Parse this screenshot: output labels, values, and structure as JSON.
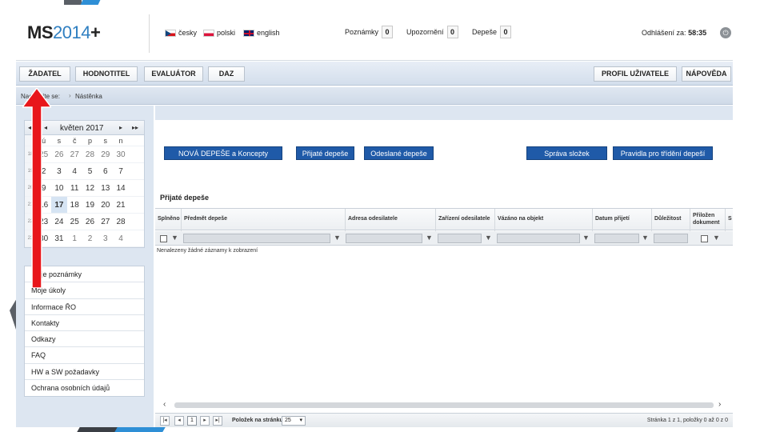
{
  "header": {
    "logo_ms": "MS",
    "logo_year": "2014",
    "logo_plus": "+",
    "languages": [
      {
        "label": "česky",
        "flag": "cz"
      },
      {
        "label": "polski",
        "flag": "pl"
      },
      {
        "label": "english",
        "flag": "gb"
      }
    ],
    "counters": [
      {
        "label": "Poznámky",
        "value": "0"
      },
      {
        "label": "Upozornění",
        "value": "0"
      },
      {
        "label": "Depeše",
        "value": "0"
      }
    ],
    "session_label": "Odhlášení za:",
    "session_time": "58:35",
    "power_icon": "power-icon"
  },
  "nav": {
    "left": [
      "ŽADATEL",
      "HODNOTITEL",
      "EVALUÁTOR",
      "DAZ"
    ],
    "right": [
      "PROFIL UŽIVATELE",
      "NÁPOVĚDA"
    ]
  },
  "breadcrumb": {
    "label": "Nacházíte se:",
    "current": "Nástěnka"
  },
  "calendar": {
    "month": "květen 2017",
    "nav": {
      "prev_year": "◂◂",
      "prev": "◂",
      "next": "▸",
      "next_year": "▸▸"
    },
    "dow": [
      "ú",
      "s",
      "č",
      "p",
      "s",
      "n"
    ],
    "weeks": [
      {
        "wk": "18",
        "days": [
          "25",
          "26",
          "27",
          "28",
          "29",
          "30"
        ]
      },
      {
        "wk": "19",
        "days": [
          "2",
          "3",
          "4",
          "5",
          "6",
          "7"
        ]
      },
      {
        "wk": "20",
        "days": [
          "9",
          "10",
          "11",
          "12",
          "13",
          "14"
        ]
      },
      {
        "wk": "21",
        "days": [
          "16",
          "17",
          "18",
          "19",
          "20",
          "21"
        ]
      },
      {
        "wk": "22",
        "days": [
          "23",
          "24",
          "25",
          "26",
          "27",
          "28"
        ]
      },
      {
        "wk": "23",
        "days": [
          "30",
          "31",
          "1",
          "2",
          "3",
          "4"
        ]
      }
    ],
    "today": "17"
  },
  "menu": [
    "Moje poznámky",
    "Moje úkoly",
    "Informace ŘO",
    "Kontakty",
    "Odkazy",
    "FAQ",
    "HW a SW požadavky",
    "Ochrana osobních údajů"
  ],
  "actions": {
    "new": "NOVÁ DEPEŠE a Koncepty",
    "received": "Přijaté depeše",
    "sent": "Odeslané depeše",
    "folders": "Správa složek",
    "rules": "Pravidla pro třídění depeší"
  },
  "grid": {
    "section_title": "Přijaté depeše",
    "columns": [
      "Splněno",
      "Předmět depeše",
      "Adresa odesilatele",
      "Zařízení odesilatele",
      "Vázáno na objekt",
      "Datum přijetí",
      "Důležitost",
      "Přiložen dokument",
      "S"
    ],
    "empty_text": "Nenalezeny žádné záznamy k zobrazení"
  },
  "pager": {
    "current_page": "1",
    "per_page_label": "Položek na stránku",
    "per_page": "25",
    "info": "Stránka 1 z 1, položky 0 až 0 z 0"
  }
}
